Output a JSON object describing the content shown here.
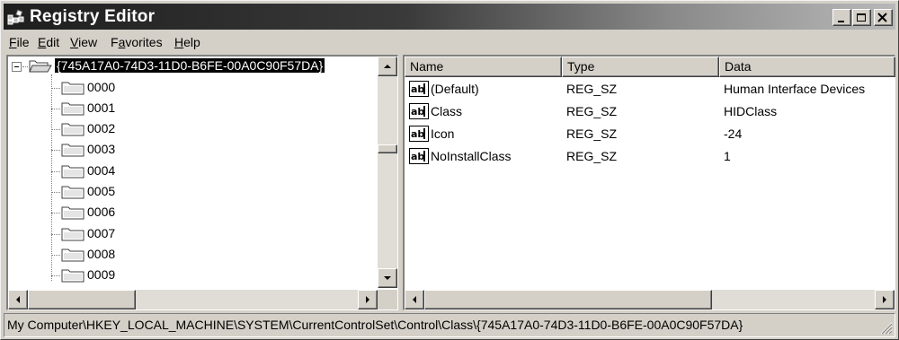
{
  "window": {
    "title": "Registry Editor"
  },
  "menu": [
    {
      "label": "File",
      "accel": "F",
      "rest": "ile"
    },
    {
      "label": "Edit",
      "accel": "E",
      "rest": "dit"
    },
    {
      "label": "View",
      "accel": "V",
      "rest": "iew"
    },
    {
      "label": "Favorites",
      "pre": "F",
      "accel": "a",
      "rest": "vorites"
    },
    {
      "label": "Help",
      "accel": "H",
      "rest": "elp"
    }
  ],
  "tree": {
    "root": "{745A17A0-74D3-11D0-B6FE-00A0C90F57DA}",
    "children": [
      "0000",
      "0001",
      "0002",
      "0003",
      "0004",
      "0005",
      "0006",
      "0007",
      "0008",
      "0009"
    ]
  },
  "list": {
    "columns": [
      "Name",
      "Type",
      "Data"
    ],
    "rows": [
      {
        "name": "(Default)",
        "type": "REG_SZ",
        "data": "Human Interface Devices"
      },
      {
        "name": "Class",
        "type": "REG_SZ",
        "data": "HIDClass"
      },
      {
        "name": "Icon",
        "type": "REG_SZ",
        "data": "-24"
      },
      {
        "name": "NoInstallClass",
        "type": "REG_SZ",
        "data": "1"
      }
    ]
  },
  "status": {
    "path": "My Computer\\HKEY_LOCAL_MACHINE\\SYSTEM\\CurrentControlSet\\Control\\Class\\{745A17A0-74D3-11D0-B6FE-00A0C90F57DA}"
  }
}
